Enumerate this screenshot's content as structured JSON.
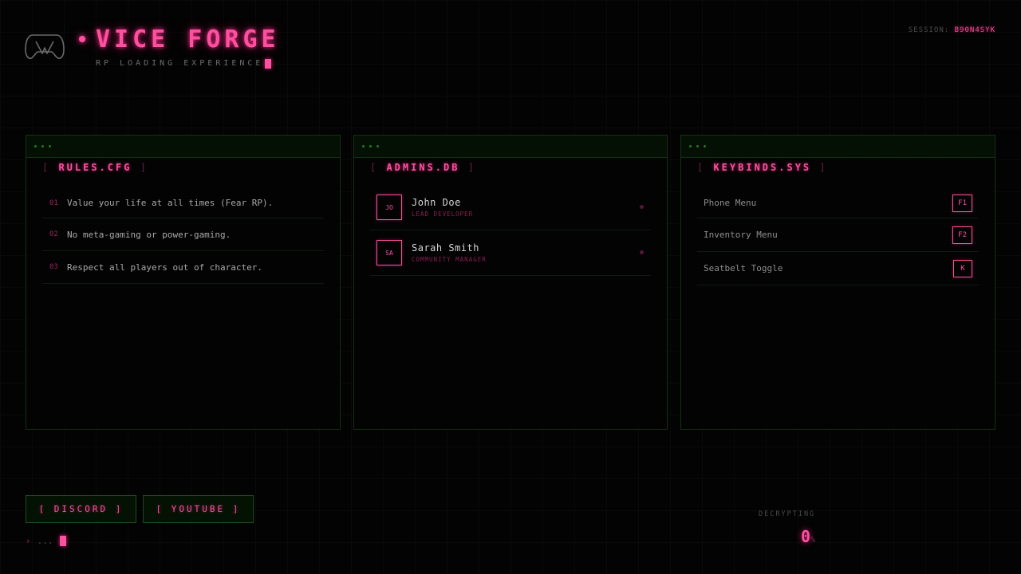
{
  "header": {
    "logo_icon": "gamepad-icon",
    "title": "VICE FORGE",
    "subtitle": "RP LOADING EXPERIENCE",
    "session_label": "SESSION:",
    "session_id": "B90N4SYK"
  },
  "panels": {
    "rules": {
      "title": "RULES.CFG",
      "items": [
        {
          "num": "01",
          "text": "Value your life at all times (Fear RP)."
        },
        {
          "num": "02",
          "text": "No meta-gaming or power-gaming."
        },
        {
          "num": "03",
          "text": "Respect all players out of character."
        }
      ]
    },
    "admins": {
      "title": "ADMINS.DB",
      "items": [
        {
          "initials": "JO",
          "name": "John Doe",
          "role": "LEAD DEVELOPER"
        },
        {
          "initials": "SA",
          "name": "Sarah Smith",
          "role": "COMMUNITY MANAGER"
        }
      ]
    },
    "keybinds": {
      "title": "KEYBINDS.SYS",
      "items": [
        {
          "label": "Phone Menu",
          "key": "F1"
        },
        {
          "label": "Inventory Menu",
          "key": "F2"
        },
        {
          "label": "Seatbelt Toggle",
          "key": "K"
        }
      ]
    }
  },
  "footer": {
    "discord_label": "[ DISCORD ]",
    "youtube_label": "[ YOUTUBE ]",
    "prompt_symbol": "›",
    "prompt_text": "...",
    "status_label": "DECRYPTING",
    "progress_value": "0",
    "progress_unit": "%"
  },
  "colors": {
    "accent": "#ff4fa1",
    "panel_border": "#163016",
    "background": "#030303"
  }
}
